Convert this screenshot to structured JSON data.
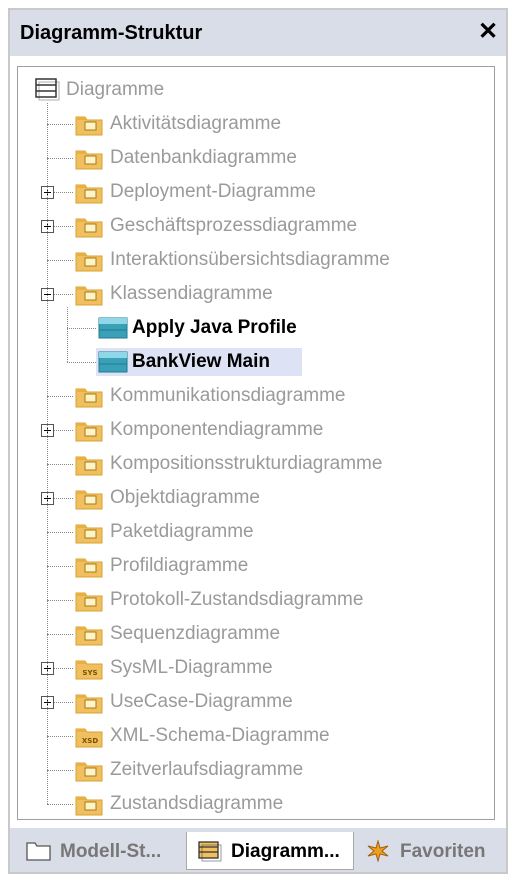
{
  "panel": {
    "title": "Diagramm-Struktur",
    "close_glyph": "✕"
  },
  "tree": {
    "root": "Diagramme",
    "items": [
      {
        "label": "Aktivitätsdiagramme",
        "icon": "activity-folder-icon"
      },
      {
        "label": "Datenbankdiagramme",
        "icon": "database-folder-icon"
      },
      {
        "label": "Deployment-Diagramme",
        "icon": "deployment-folder-icon",
        "expander": "+"
      },
      {
        "label": "Geschäftsprozessdiagramme",
        "icon": "business-process-folder-icon",
        "expander": "+"
      },
      {
        "label": "Interaktionsübersichtsdiagramme",
        "icon": "interaction-overview-folder-icon"
      },
      {
        "label": "Klassendiagramme",
        "icon": "class-folder-icon",
        "expander": "-"
      },
      {
        "label": "Apply Java Profile",
        "icon": "class-diagram-icon",
        "child": true
      },
      {
        "label": "BankView Main",
        "icon": "class-diagram-icon",
        "child": true,
        "selected": true
      },
      {
        "label": "Kommunikationsdiagramme",
        "icon": "communication-folder-icon"
      },
      {
        "label": "Komponentendiagramme",
        "icon": "component-folder-icon",
        "expander": "+"
      },
      {
        "label": "Kompositionsstrukturdiagramme",
        "icon": "composite-structure-folder-icon"
      },
      {
        "label": "Objektdiagramme",
        "icon": "object-folder-icon",
        "expander": "+"
      },
      {
        "label": "Paketdiagramme",
        "icon": "package-folder-icon"
      },
      {
        "label": "Profildiagramme",
        "icon": "profile-folder-icon"
      },
      {
        "label": "Protokoll-Zustandsdiagramme",
        "icon": "protocol-state-folder-icon"
      },
      {
        "label": "Sequenzdiagramme",
        "icon": "sequence-folder-icon"
      },
      {
        "label": "SysML-Diagramme",
        "icon": "sysml-folder-icon",
        "expander": "+",
        "badge": "SYS"
      },
      {
        "label": "UseCase-Diagramme",
        "icon": "usecase-folder-icon",
        "expander": "+"
      },
      {
        "label": "XML-Schema-Diagramme",
        "icon": "xml-schema-folder-icon",
        "badge": "XSD"
      },
      {
        "label": "Zeitverlaufsdiagramme",
        "icon": "timing-folder-icon"
      },
      {
        "label": "Zustandsdiagramme",
        "icon": "state-folder-icon"
      }
    ]
  },
  "tabs": [
    {
      "label": "Modell-St...",
      "icon": "folder-icon",
      "active": false
    },
    {
      "label": "Diagramm...",
      "icon": "diagrams-icon",
      "active": true
    },
    {
      "label": "Favoriten",
      "icon": "favorites-icon",
      "active": false
    }
  ],
  "colors": {
    "titlebar": "#d9dde8",
    "folder": "#f0c060",
    "folder_border": "#d9a030",
    "class_icon": "#3aa0b8",
    "selected_bg": "#dde3f5",
    "muted_text": "#9a9a9a"
  }
}
